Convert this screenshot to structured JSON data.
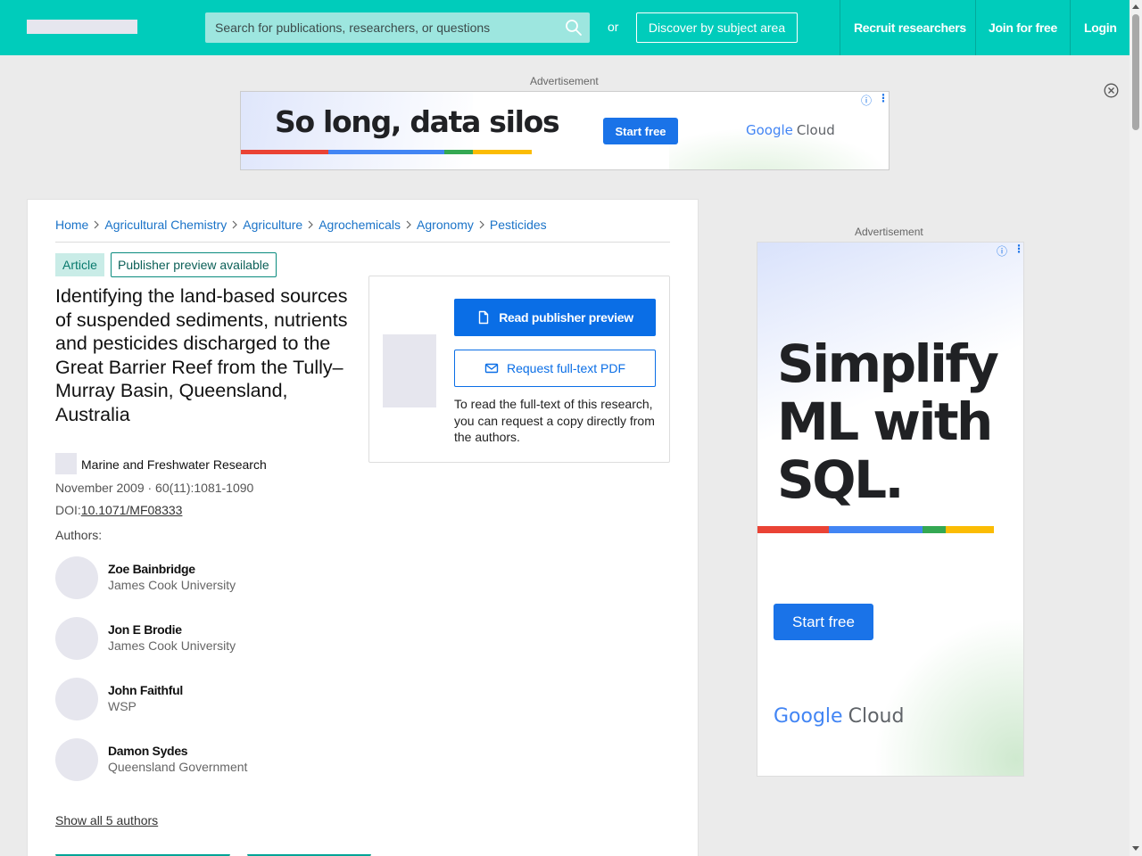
{
  "header": {
    "search_placeholder": "Search for publications, researchers, or questions",
    "search_icon": "search-icon",
    "or_text": "or",
    "discover_label": "Discover by subject area",
    "nav": {
      "recruit": "Recruit researchers",
      "join": "Join for free",
      "login": "Login"
    },
    "accent_color": "#00ccbb"
  },
  "ads": {
    "top": {
      "label": "Advertisement",
      "headline": "So long, data silos",
      "cta": "Start free",
      "brand_a": "Google",
      "brand_b": "Cloud"
    },
    "side": {
      "label": "Advertisement",
      "headline": "Simplify ML with SQL.",
      "cta": "Start free",
      "brand_a": "Google",
      "brand_b": "Cloud"
    }
  },
  "breadcrumb": [
    "Home",
    "Agricultural Chemistry",
    "Agriculture",
    "Agrochemicals",
    "Agronomy",
    "Pesticides"
  ],
  "article": {
    "type_tag": "Article",
    "preview_tag": "Publisher preview available",
    "title": "Identifying the land-based sources of suspended sediments, nutrients and pesticides discharged to the Great Barrier Reef from the Tully–Murray Basin, Queensland, Australia",
    "journal": "Marine and Freshwater Research",
    "date_volume": "November 2009 · 60(11):1081-1090",
    "doi_prefix": "DOI:",
    "doi": "10.1071/MF08333",
    "authors_label": "Authors:",
    "authors": [
      {
        "name": "Zoe Bainbridge",
        "affiliation": "James Cook University"
      },
      {
        "name": "Jon E Brodie",
        "affiliation": "James Cook University"
      },
      {
        "name": "John Faithful",
        "affiliation": "WSP"
      },
      {
        "name": "Damon Sydes",
        "affiliation": "Queensland Government"
      }
    ],
    "show_all": "Show all 5 authors"
  },
  "actions": {
    "read_preview": "Read publisher preview",
    "request_pdf": "Request full-text PDF",
    "note": "To read the full-text of this research, you can request a copy directly from the authors."
  }
}
